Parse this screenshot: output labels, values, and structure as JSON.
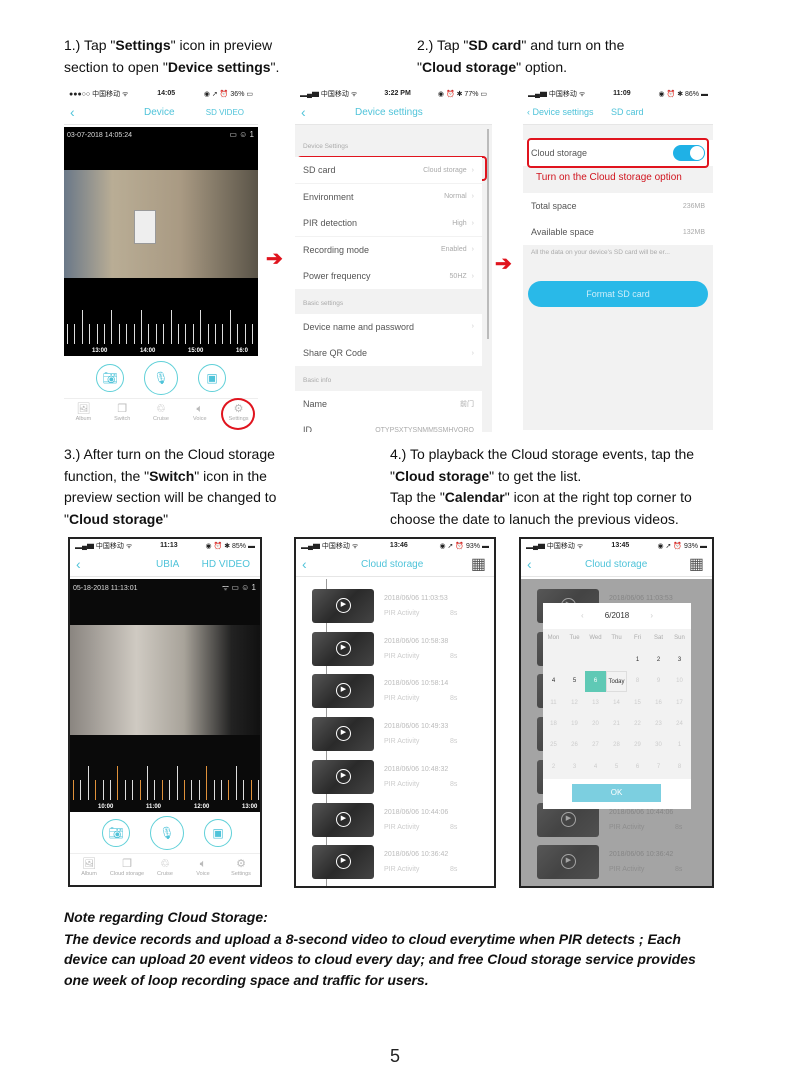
{
  "colors": {
    "accent": "#4fc3d9",
    "highlight": "#e0141e",
    "toggle": "#1fb1e6",
    "selected_day": "#5fc9b5"
  },
  "step1": {
    "pre": "1.) Tap \"",
    "b1": "Settings",
    "mid": "\" icon in preview",
    "line2_pre": "section to open \"",
    "b2": "Device settings",
    "line2_post": "\"."
  },
  "step2": {
    "pre": "2.) Tap \"",
    "b1": "SD card",
    "mid": "\" and turn on the",
    "line2_pre": "\"",
    "b2": "Cloud storage",
    "line2_post": "\" option."
  },
  "step3": {
    "l1": "3.) After turn on the Cloud storage",
    "l2_pre": "function, the \"",
    "l2_b": "Switch",
    "l2_post": "\" icon in the",
    "l3": "preview section will be changed to",
    "l4_pre": "\"",
    "l4_b": "Cloud storage",
    "l4_post": "\""
  },
  "step4": {
    "l1": "4.) To playback the Cloud storage events, tap the",
    "l2_pre": "\"",
    "l2_b": "Cloud storage",
    "l2_post": "\" to get the list.",
    "l3_pre": "Tap the \"",
    "l3_b": "Calendar",
    "l3_post": "\" icon at the right top corner to",
    "l4": "choose the date to lanuch the previous videos."
  },
  "phone1": {
    "carrier": "●●●○○ 中国移动 ᯤ",
    "time": "14:05",
    "battery": "◉ ➚ ⏰ 36% ▭",
    "title": "Device",
    "right": "SD VIDEO",
    "timestamp": "03-07-2018 14:05:24",
    "viewers": "1",
    "timeline": [
      "13:00",
      "14:00",
      "15:00",
      "16:0"
    ],
    "tabs": [
      {
        "label": "Album",
        "icon": "image-icon"
      },
      {
        "label": "Switch",
        "icon": "switch-icon"
      },
      {
        "label": "Cruise",
        "icon": "recycle-icon"
      },
      {
        "label": "Voice",
        "icon": "speaker-icon"
      },
      {
        "label": "Settings",
        "icon": "gear-icon"
      }
    ]
  },
  "phone2": {
    "carrier": "▂▄▆ 中国移动 ᯤ",
    "time": "3:22 PM",
    "battery": "◉ ⏰ ✱ 77% ▭",
    "title": "Device settings",
    "sections": [
      {
        "title": "Device Settings",
        "rows": [
          {
            "label": "SD card",
            "value": "Cloud storage"
          },
          {
            "label": "Environment",
            "value": "Normal"
          },
          {
            "label": "PIR detection",
            "value": "High"
          },
          {
            "label": "Recording mode",
            "value": "Enabled"
          },
          {
            "label": "Power frequency",
            "value": "50HZ"
          }
        ]
      },
      {
        "title": "Basic settings",
        "rows": [
          {
            "label": "Device name and password",
            "value": ""
          },
          {
            "label": "Share QR Code",
            "value": ""
          }
        ]
      },
      {
        "title": "Basic info",
        "rows": [
          {
            "label": "Name",
            "value": "前门"
          },
          {
            "label": "ID",
            "value": "OTYPSXTYSNMM5SMHVORQ"
          }
        ]
      }
    ]
  },
  "phone3": {
    "carrier": "▂▄▆ 中国移动 ᯤ",
    "time": "11:09",
    "battery": "◉ ⏰ ✱ 86% ▬",
    "back_label": "Device settings",
    "title": "SD card",
    "toggle_label": "Cloud storage",
    "toggle_on": true,
    "annotation": "Turn on the Cloud storage option",
    "total_label": "Total space",
    "total_value": "236MB",
    "avail_label": "Available space",
    "avail_value": "132MB",
    "warning": "All the data on your device's SD card will be er...",
    "format_button": "Format SD card"
  },
  "phone4": {
    "carrier": "▂▄▆ 中国移动 ᯤ",
    "time": "11:13",
    "battery": "◉ ⏰ ✱ 85% ▬",
    "title": "UBIA",
    "right": "HD VIDEO",
    "timestamp": "05-18-2018 11:13:01",
    "viewers": "1",
    "timeline": [
      "10:00",
      "11:00",
      "12:00",
      "13:00"
    ],
    "tabs": [
      {
        "label": "Album",
        "icon": "image-icon"
      },
      {
        "label": "Cloud storage",
        "icon": "cloud-storage-icon"
      },
      {
        "label": "Cruise",
        "icon": "recycle-icon"
      },
      {
        "label": "Voice",
        "icon": "speaker-icon"
      },
      {
        "label": "Settings",
        "icon": "gear-icon"
      }
    ]
  },
  "phone5": {
    "carrier": "▂▄▆ 中国移动 ᯤ",
    "time": "13:46",
    "battery": "◉ ➚ ⏰ 93% ▬",
    "title": "Cloud storage",
    "events": [
      {
        "date": "2018/06/06 11:03:53",
        "type": "PIR Activity",
        "duration": "8s"
      },
      {
        "date": "2018/06/06 10:58:38",
        "type": "PIR Activity",
        "duration": "8s"
      },
      {
        "date": "2018/06/06 10:58:14",
        "type": "PIR Activity",
        "duration": "8s"
      },
      {
        "date": "2018/06/06 10:49:33",
        "type": "PIR Activity",
        "duration": "8s"
      },
      {
        "date": "2018/06/06 10:48:32",
        "type": "PIR Activity",
        "duration": "8s"
      },
      {
        "date": "2018/06/06 10:44:06",
        "type": "PIR Activity",
        "duration": "8s"
      },
      {
        "date": "2018/06/06 10:36:42",
        "type": "PIR Activity",
        "duration": "8s"
      }
    ]
  },
  "phone6": {
    "carrier": "▂▄▆ 中国移动 ᯤ",
    "time": "13:45",
    "battery": "◉ ➚ ⏰ 93% ▬",
    "title": "Cloud storage",
    "calendar": {
      "month": "6/2018",
      "weekdays": [
        "Mon",
        "Tue",
        "Wed",
        "Thu",
        "Fri",
        "Sat",
        "Sun"
      ],
      "weeks": [
        [
          "",
          "",
          "",
          "",
          "1",
          "2",
          "3"
        ],
        [
          "4",
          "5",
          "6",
          "Today",
          "8",
          "9",
          "10"
        ],
        [
          "11",
          "12",
          "13",
          "14",
          "15",
          "16",
          "17"
        ],
        [
          "18",
          "19",
          "20",
          "21",
          "22",
          "23",
          "24"
        ],
        [
          "25",
          "26",
          "27",
          "28",
          "29",
          "30",
          "1"
        ],
        [
          "2",
          "3",
          "4",
          "5",
          "6",
          "7",
          "8"
        ]
      ],
      "selected": "6",
      "ok": "OK"
    }
  },
  "note": {
    "title": "Note regarding Cloud Storage:",
    "lines": [
      "The device records and upload a 8-second video to cloud everytime when PIR detects ; Each",
      "device can upload 20 event videos to cloud every day; and free Cloud storage service provides",
      "one week of loop recording space and traffic for users."
    ]
  },
  "page_number": "5"
}
